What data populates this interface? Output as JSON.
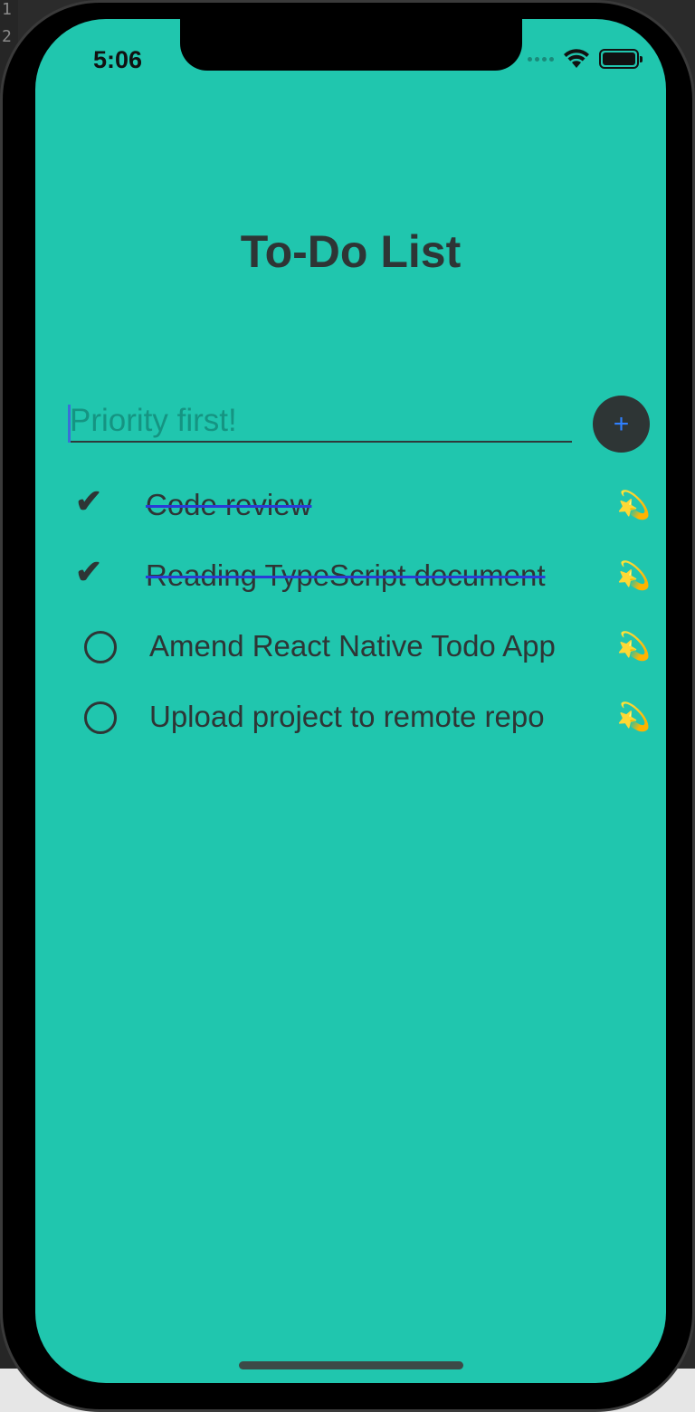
{
  "editor": {
    "line_numbers": [
      "1",
      "2"
    ]
  },
  "status_bar": {
    "time": "5:06"
  },
  "header": {
    "title": "To-Do List"
  },
  "input": {
    "placeholder": "Priority first!",
    "value": ""
  },
  "add_button": {
    "label": "+"
  },
  "todos": [
    {
      "text": "Code review",
      "done": true,
      "check_symbol": "✔",
      "action_icon": "💫"
    },
    {
      "text": "Reading TypeScript document",
      "done": true,
      "check_symbol": "✔",
      "action_icon": "💫"
    },
    {
      "text": "Amend React Native Todo App",
      "done": false,
      "check_symbol": "",
      "action_icon": "💫"
    },
    {
      "text": "Upload project to remote repo",
      "done": false,
      "check_symbol": "",
      "action_icon": "💫"
    }
  ],
  "colors": {
    "background": "#20c6ae",
    "text": "#2e3535",
    "strike": "#2a3ad8",
    "button": "#2e3535",
    "button_plus": "#2f80ff"
  },
  "icons": {
    "status": [
      "signal-dots-icon",
      "wifi-icon",
      "battery-icon"
    ],
    "todo_action": "dizzy-star-icon"
  }
}
